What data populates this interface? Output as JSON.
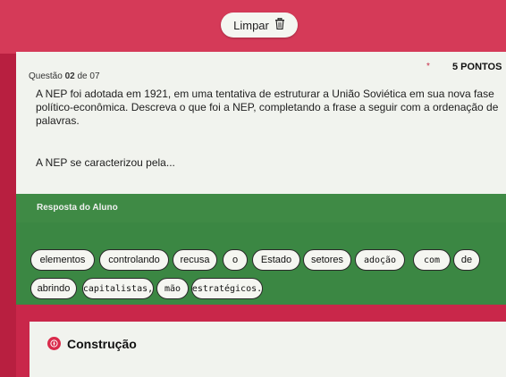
{
  "header": {
    "clear_label": "Limpar"
  },
  "question": {
    "label_prefix": "Questão",
    "number": "02",
    "label_suffix": "de 07",
    "points": "5 PONTOS",
    "text": "A NEP foi adotada em 1921, em uma tentativa de estruturar a União Soviética em sua nova fase político-econômica. Descreva o que foi a NEP, completando a frase a seguir com a ordenação de palavras.",
    "prompt": "A NEP se caracterizou pela..."
  },
  "answer": {
    "label": "Resposta do Aluno",
    "words": [
      "elementos",
      "controlando",
      "recusa",
      "o",
      "Estado",
      "setores",
      "adoção",
      "com",
      "de",
      "abrindo",
      "capitalistas,",
      "mão",
      "estratégicos."
    ]
  },
  "section": {
    "title": "Construção"
  }
}
